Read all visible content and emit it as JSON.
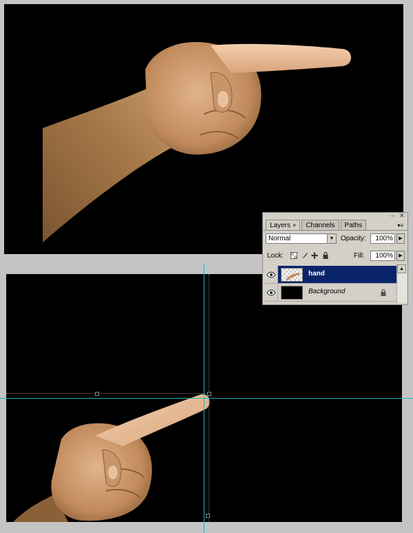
{
  "layers_panel": {
    "tabs": [
      {
        "label": "Layers",
        "close": "×",
        "active": true
      },
      {
        "label": "Channels",
        "active": false
      },
      {
        "label": "Paths",
        "active": false
      }
    ],
    "blend_mode": "Normal",
    "opacity_label": "Opacity:",
    "opacity_value": "100%",
    "lock_label": "Lock:",
    "fill_label": "Fill:",
    "fill_value": "100%",
    "layers": [
      {
        "name": "hand",
        "selected": true,
        "visible": true
      },
      {
        "name": "Background",
        "selected": false,
        "visible": true,
        "locked": true
      }
    ]
  },
  "icons": [
    "minimize-icon",
    "close-icon",
    "panel-menu-icon",
    "dropdown-arrow-icon",
    "eye-icon",
    "lock-icon",
    "move-icon",
    "brush-icon",
    "transparency-lock-icon"
  ],
  "colors": {
    "canvas": "#000000",
    "workspace": "#c4c4c4",
    "panel": "#d4d0c8",
    "selected_layer": "#0a246a",
    "guide": "#1fb3b8",
    "skin": "#d29a6c"
  }
}
